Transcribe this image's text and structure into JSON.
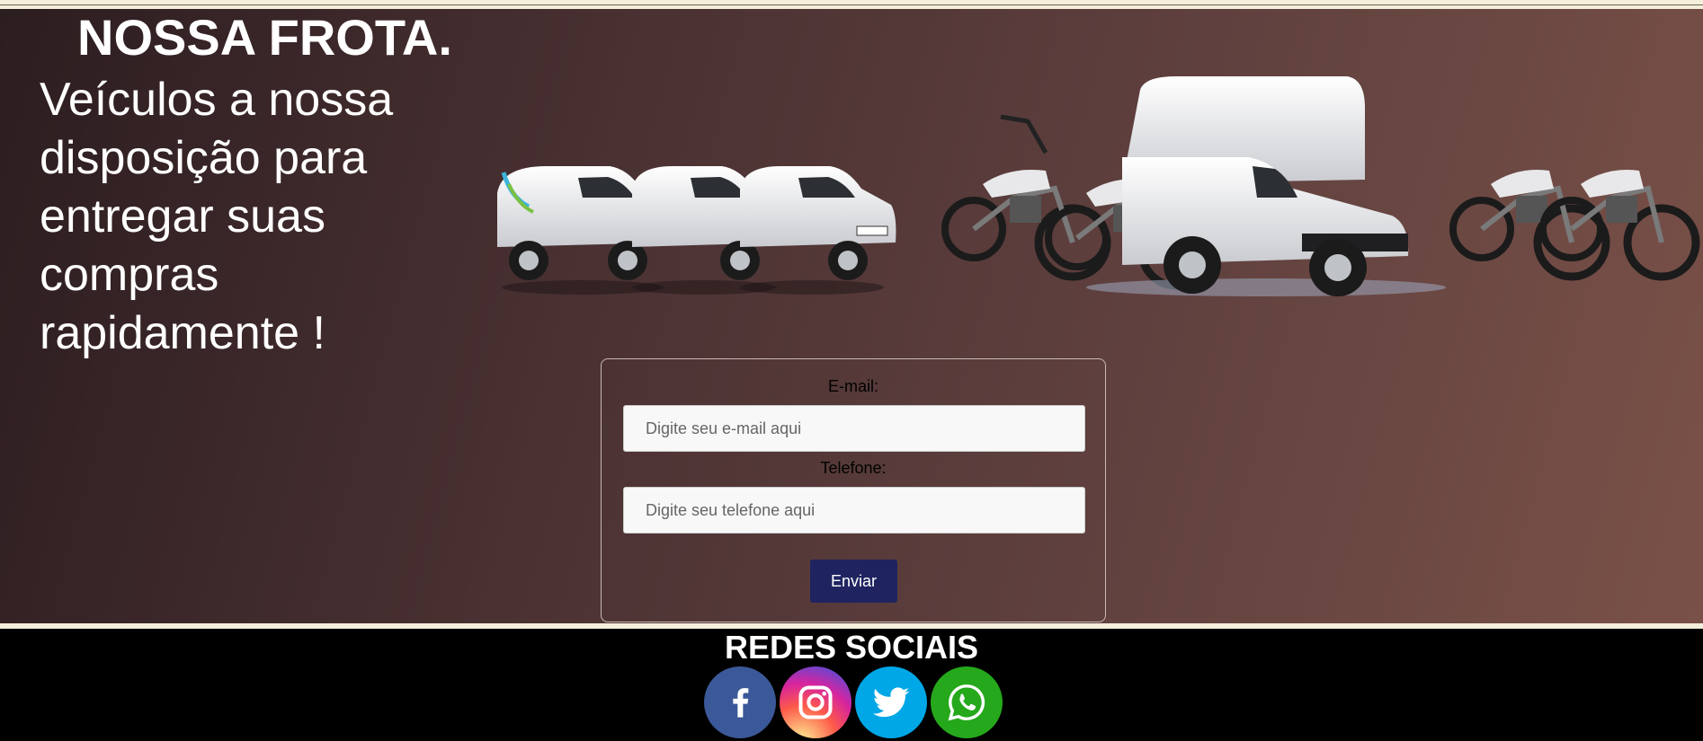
{
  "hero": {
    "title": "NOSSA FROTA.",
    "text": "Veículos a nossa disposição para entregar suas compras rapidamente !"
  },
  "form": {
    "email_label": "E-mail:",
    "email_placeholder": "Digite seu e-mail aqui",
    "phone_label": "Telefone:",
    "phone_placeholder": "Digite seu telefone aqui",
    "submit_label": "Enviar"
  },
  "footer": {
    "title": "REDES SOCIAIS",
    "icons": [
      "facebook-icon",
      "instagram-icon",
      "twitter-icon",
      "whatsapp-icon"
    ]
  },
  "colors": {
    "button": "#1f2460",
    "facebook": "#3b5998",
    "twitter": "#00a7e6",
    "whatsapp": "#25a81b"
  }
}
